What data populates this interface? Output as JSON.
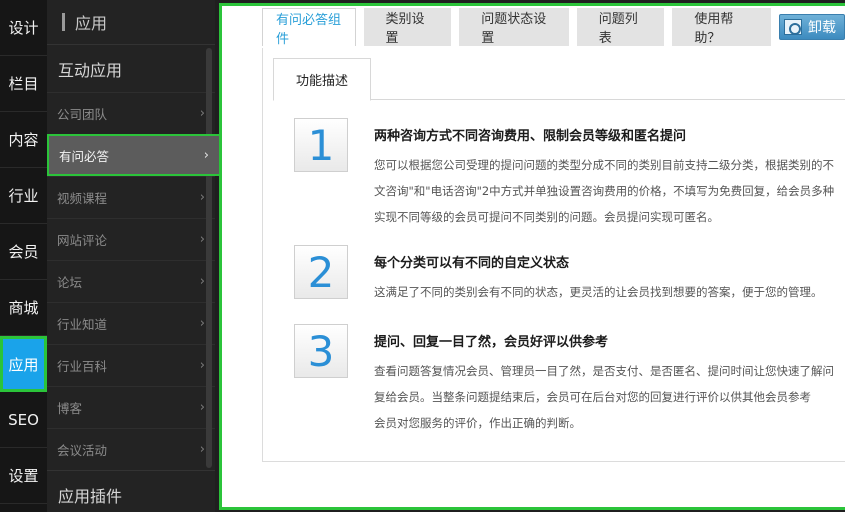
{
  "rail": [
    "设计",
    "栏目",
    "内容",
    "行业",
    "会员",
    "商城",
    "应用",
    "SEO",
    "设置"
  ],
  "rail_active": 6,
  "sidebar": {
    "header": "应用",
    "group1": "互动应用",
    "items": [
      {
        "label": "公司团队"
      },
      {
        "label": "有问必答"
      },
      {
        "label": "视频课程"
      },
      {
        "label": "网站评论"
      },
      {
        "label": "论坛"
      },
      {
        "label": "行业知道"
      },
      {
        "label": "行业百科"
      },
      {
        "label": "博客"
      },
      {
        "label": "会议活动"
      }
    ],
    "active_index": 1,
    "group2": "应用插件",
    "chevron": "›"
  },
  "tabs": [
    "有问必答组件",
    "类别设置",
    "问题状态设置",
    "问题列表",
    "使用帮助？"
  ],
  "uninstall_label": "卸载",
  "subtab": "功能描述",
  "features": [
    {
      "num": "1",
      "title": "两种咨询方式不同咨询费用、限制会员等级和匿名提问",
      "lines": [
        "您可以根据您公司受理的提问问题的类型分成不同的类别目前支持二级分类，根据类别的不",
        "文咨询\"和\"电话咨询\"2中方式并单独设置咨询费用的价格，不填写为免费回复，给会员多种",
        "实现不同等级的会员可提问不同类别的问题。会员提问实现可匿名。"
      ]
    },
    {
      "num": "2",
      "title": "每个分类可以有不同的自定义状态",
      "lines": [
        "这满足了不同的类别会有不同的状态，更灵活的让会员找到想要的答案，便于您的管理。"
      ]
    },
    {
      "num": "3",
      "title": "提问、回复一目了然，会员好评以供参考",
      "lines": [
        "查看问题答复情况会员、管理员一目了然，是否支付、是否匿名、提问时间让您快速了解问",
        "复给会员。当整条问题提结束后，会员可在后台对您的回复进行评价以供其他会员参考",
        "会员对您服务的评价，作出正确的判断。"
      ]
    }
  ]
}
